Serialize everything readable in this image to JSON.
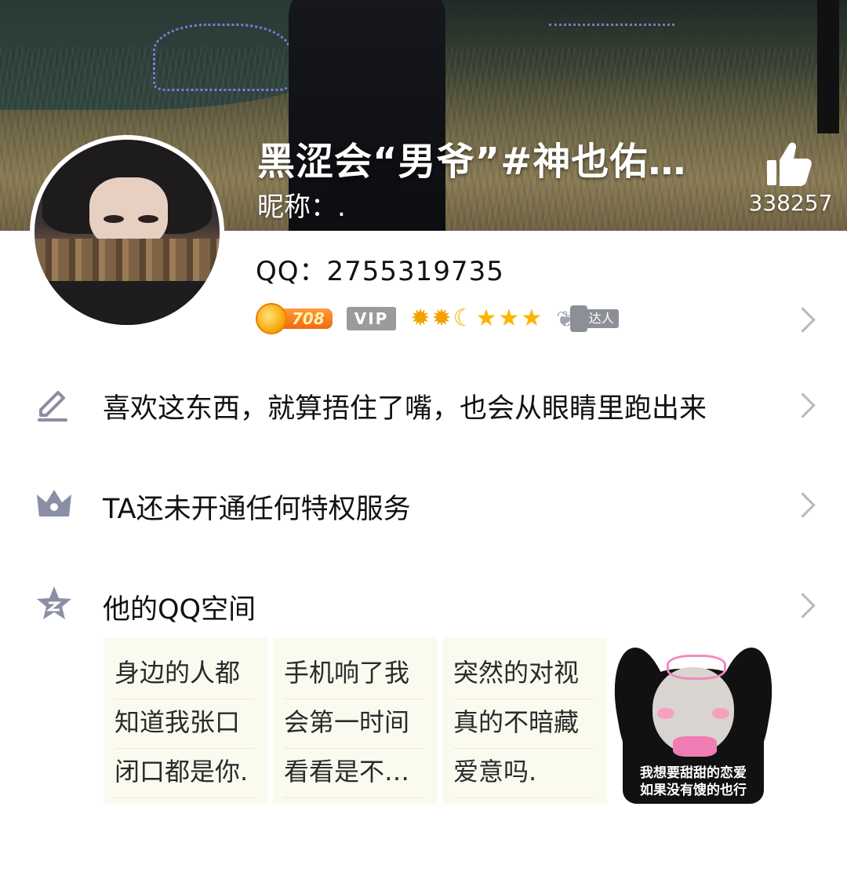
{
  "header": {
    "title": "黑涩会“男爷”#神也佑…",
    "nickname": "昵称：.",
    "like_count": "338257"
  },
  "profile": {
    "qq_label": "QQ：2755319735",
    "level_number": "708",
    "vip_label": "VIP",
    "level_icons": [
      "sun",
      "sun",
      "moon",
      "star",
      "star",
      "star"
    ],
    "talent_label": "达人"
  },
  "rows": {
    "signature": "喜欢这东西，就算捂住了嘴，也会从眼睛里跑出来",
    "privilege": "TA还未开通任何特权服务",
    "qzone": "他的QQ空间"
  },
  "qzone_cards": [
    {
      "lines": [
        "身边的人都",
        "知道我张口",
        "闭口都是你."
      ]
    },
    {
      "lines": [
        "手机响了我",
        "会第一时间",
        "看看是不…"
      ]
    },
    {
      "lines": [
        "突然的对视",
        "真的不暗藏",
        "爱意吗."
      ]
    }
  ],
  "meme_caption": [
    "我想要甜甜的恋爱",
    "如果没有馊的也行"
  ],
  "colors": {
    "accent_orange": "#f06a10",
    "icon_gray": "#8a8fa3",
    "card_bg": "#fbfaef",
    "chevron": "#b8b8be"
  }
}
